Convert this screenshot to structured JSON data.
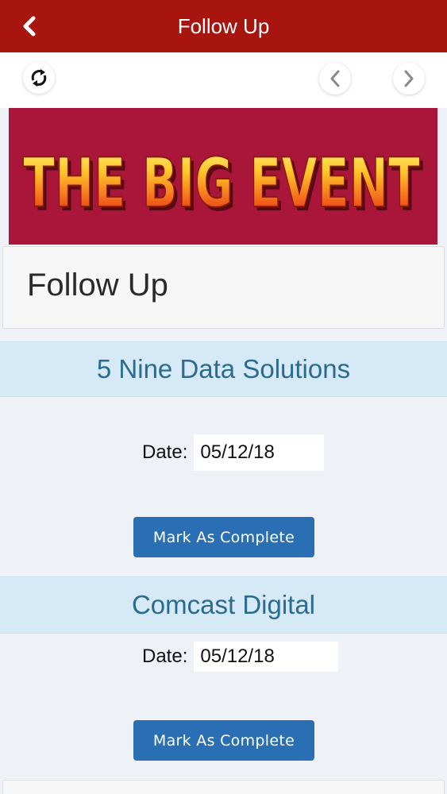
{
  "header": {
    "title": "Follow Up",
    "back_icon": "chevron-left-icon"
  },
  "toolbar": {
    "refresh_icon": "refresh-icon",
    "prev_icon": "chevron-left-icon",
    "next_icon": "chevron-right-icon"
  },
  "banner": {
    "text": "THE BIG EVENT",
    "background_color": "#a9163a"
  },
  "page": {
    "title": "Follow Up"
  },
  "followups": [
    {
      "company": "5 Nine Data Solutions",
      "date_label": "Date:",
      "date_value": "05/12/18",
      "button_label": "Mark As Complete"
    },
    {
      "company": "Comcast Digital",
      "date_label": "Date:",
      "date_value": "05/12/18",
      "button_label": "Mark As Complete"
    }
  ],
  "colors": {
    "header_bg": "#a8150f",
    "item_header_bg": "#d6e9f6",
    "item_header_text": "#2b6b8e",
    "button_bg": "#2a6fb3"
  }
}
